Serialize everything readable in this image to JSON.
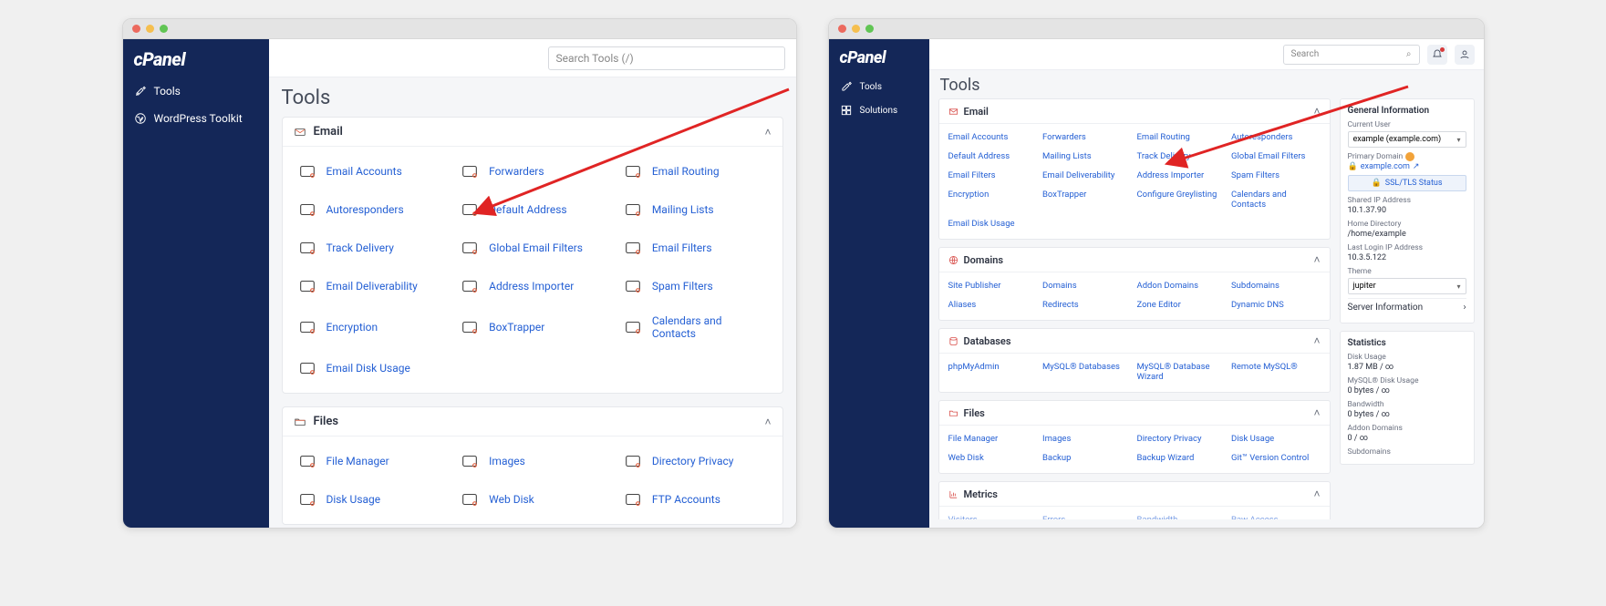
{
  "left": {
    "search_placeholder": "Search Tools (/)",
    "page_title": "Tools",
    "sidebar": {
      "logo": "cPanel",
      "items": [
        {
          "label": "Tools"
        },
        {
          "label": "WordPress Toolkit"
        }
      ]
    },
    "panels": {
      "email": {
        "title": "Email",
        "items": [
          "Email Accounts",
          "Forwarders",
          "Email Routing",
          "Autoresponders",
          "Default Address",
          "Mailing Lists",
          "Track Delivery",
          "Global Email Filters",
          "Email Filters",
          "Email Deliverability",
          "Address Importer",
          "Spam Filters",
          "Encryption",
          "BoxTrapper",
          "Calendars and Contacts",
          "Email Disk Usage"
        ]
      },
      "files": {
        "title": "Files",
        "items": [
          "File Manager",
          "Images",
          "Directory Privacy",
          "Disk Usage",
          "Web Disk",
          "FTP Accounts"
        ]
      }
    }
  },
  "right": {
    "search_placeholder": "Search",
    "page_title": "Tools",
    "sidebar": {
      "logo": "cPanel",
      "items": [
        {
          "label": "Tools"
        },
        {
          "label": "Solutions"
        }
      ]
    },
    "panels": {
      "email": {
        "title": "Email",
        "items": [
          "Email Accounts",
          "Forwarders",
          "Email Routing",
          "Autoresponders",
          "Default Address",
          "Mailing Lists",
          "Track Delivery",
          "Global Email Filters",
          "Email Filters",
          "Email Deliverability",
          "Address Importer",
          "Spam Filters",
          "Encryption",
          "BoxTrapper",
          "Configure Greylisting",
          "Calendars and Contacts",
          "Email Disk Usage"
        ]
      },
      "domains": {
        "title": "Domains",
        "items": [
          "Site Publisher",
          "Domains",
          "Addon Domains",
          "Subdomains",
          "Aliases",
          "Redirects",
          "Zone Editor",
          "Dynamic DNS"
        ]
      },
      "databases": {
        "title": "Databases",
        "items": [
          "phpMyAdmin",
          "MySQL® Databases",
          "MySQL® Database Wizard",
          "Remote MySQL®"
        ]
      },
      "files": {
        "title": "Files",
        "items": [
          "File Manager",
          "Images",
          "Directory Privacy",
          "Disk Usage",
          "Web Disk",
          "Backup",
          "Backup Wizard",
          "Git™ Version Control"
        ]
      },
      "metrics": {
        "title": "Metrics",
        "items": [
          "Visitors",
          "Errors",
          "Bandwidth",
          "Raw Access"
        ]
      }
    },
    "info": {
      "title": "General Information",
      "current_user_label": "Current User",
      "current_user_value": "example (example.com)",
      "primary_domain_label": "Primary Domain",
      "primary_domain_value": "example.com",
      "ssl_button": "SSL/TLS Status",
      "shared_ip_label": "Shared IP Address",
      "shared_ip_value": "10.1.37.90",
      "home_dir_label": "Home Directory",
      "home_dir_value": "/home/example",
      "last_login_label": "Last Login IP Address",
      "last_login_value": "10.3.5.122",
      "theme_label": "Theme",
      "theme_value": "jupiter",
      "server_info": "Server Information"
    },
    "stats": {
      "title": "Statistics",
      "rows": [
        {
          "label": "Disk Usage",
          "value": "1.87 MB / ∞"
        },
        {
          "label": "MySQL® Disk Usage",
          "value": "0 bytes / ∞"
        },
        {
          "label": "Bandwidth",
          "value": "0 bytes / ∞"
        },
        {
          "label": "Addon Domains",
          "value": "0 / ∞"
        },
        {
          "label": "Subdomains",
          "value": ""
        }
      ]
    }
  }
}
